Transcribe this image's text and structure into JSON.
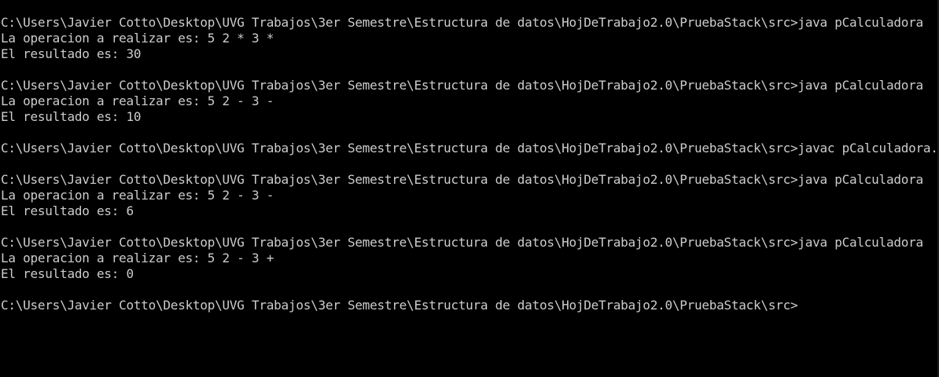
{
  "theme": {
    "background": "#000000",
    "text": "#cccccc"
  },
  "console": {
    "lines": [
      "C:\\Users\\Javier Cotto\\Desktop\\UVG Trabajos\\3er Semestre\\Estructura de datos\\HojDeTrabajo2.0\\PruebaStack\\src>java pCalculadora",
      "La operacion a realizar es: 5 2 * 3 *",
      "El resultado es: 30",
      "",
      "C:\\Users\\Javier Cotto\\Desktop\\UVG Trabajos\\3er Semestre\\Estructura de datos\\HojDeTrabajo2.0\\PruebaStack\\src>java pCalculadora",
      "La operacion a realizar es: 5 2 - 3 -",
      "El resultado es: 10",
      "",
      "C:\\Users\\Javier Cotto\\Desktop\\UVG Trabajos\\3er Semestre\\Estructura de datos\\HojDeTrabajo2.0\\PruebaStack\\src>javac pCalculadora.java",
      "",
      "C:\\Users\\Javier Cotto\\Desktop\\UVG Trabajos\\3er Semestre\\Estructura de datos\\HojDeTrabajo2.0\\PruebaStack\\src>java pCalculadora",
      "La operacion a realizar es: 5 2 - 3 -",
      "El resultado es: 6",
      "",
      "C:\\Users\\Javier Cotto\\Desktop\\UVG Trabajos\\3er Semestre\\Estructura de datos\\HojDeTrabajo2.0\\PruebaStack\\src>java pCalculadora",
      "La operacion a realizar es: 5 2 - 3 +",
      "El resultado es: 0",
      "",
      "C:\\Users\\Javier Cotto\\Desktop\\UVG Trabajos\\3er Semestre\\Estructura de datos\\HojDeTrabajo2.0\\PruebaStack\\src>"
    ]
  }
}
